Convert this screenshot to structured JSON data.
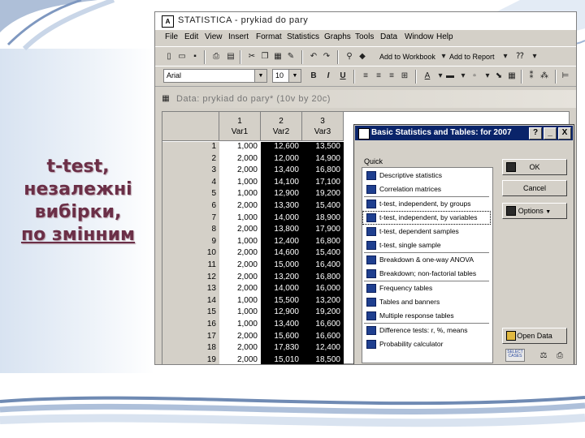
{
  "slide": {
    "title_lines": [
      "t-test,",
      "незалежні",
      "вибірки,",
      "по змінним"
    ]
  },
  "app": {
    "title": "STATISTICA - prykiad do pary",
    "icon_label": "A",
    "menu": [
      "File",
      "Edit",
      "View",
      "Insert",
      "Format",
      "Statistics",
      "Graphs",
      "Tools",
      "Data",
      "Window",
      "Help"
    ],
    "toolbar1": {
      "add_to_workbook": "Add to Workbook",
      "add_to_report": "Add to Report"
    },
    "toolbar2": {
      "font": "Arial",
      "size": "10",
      "bold": "B",
      "italic": "I",
      "underline": "U"
    }
  },
  "data_window": {
    "title": "Data: prykiad do pary* (10v by 20c)",
    "columns": [
      {
        "num": "1",
        "name": "Var1"
      },
      {
        "num": "2",
        "name": "Var2"
      },
      {
        "num": "3",
        "name": "Var3"
      }
    ],
    "rows": [
      {
        "n": "1",
        "v1": "1,000",
        "v2": "12,600",
        "v3": "13,500"
      },
      {
        "n": "2",
        "v1": "2,000",
        "v2": "12,000",
        "v3": "14,900"
      },
      {
        "n": "3",
        "v1": "2,000",
        "v2": "13,400",
        "v3": "16,800"
      },
      {
        "n": "4",
        "v1": "1,000",
        "v2": "14,100",
        "v3": "17,100"
      },
      {
        "n": "5",
        "v1": "1,000",
        "v2": "12,900",
        "v3": "19,200"
      },
      {
        "n": "6",
        "v1": "2,000",
        "v2": "13,300",
        "v3": "15,400"
      },
      {
        "n": "7",
        "v1": "1,000",
        "v2": "14,000",
        "v3": "18,900"
      },
      {
        "n": "8",
        "v1": "2,000",
        "v2": "13,800",
        "v3": "17,900"
      },
      {
        "n": "9",
        "v1": "1,000",
        "v2": "12,400",
        "v3": "16,800"
      },
      {
        "n": "10",
        "v1": "2,000",
        "v2": "14,600",
        "v3": "15,400"
      },
      {
        "n": "11",
        "v1": "2,000",
        "v2": "15,000",
        "v3": "16,400"
      },
      {
        "n": "12",
        "v1": "2,000",
        "v2": "13,200",
        "v3": "16,800"
      },
      {
        "n": "13",
        "v1": "2,000",
        "v2": "14,000",
        "v3": "16,000"
      },
      {
        "n": "14",
        "v1": "1,000",
        "v2": "15,500",
        "v3": "13,200"
      },
      {
        "n": "15",
        "v1": "1,000",
        "v2": "12,900",
        "v3": "19,200"
      },
      {
        "n": "16",
        "v1": "1,000",
        "v2": "13,400",
        "v3": "16,600"
      },
      {
        "n": "17",
        "v1": "2,000",
        "v2": "15,600",
        "v3": "16,600"
      },
      {
        "n": "18",
        "v1": "2,000",
        "v2": "17,830",
        "v3": "12,400"
      },
      {
        "n": "19",
        "v1": "2,000",
        "v2": "15,010",
        "v3": "18,500"
      }
    ]
  },
  "dialog": {
    "title": "Basic Statistics and Tables: for 2007",
    "help": "?",
    "minimize": "_",
    "close": "X",
    "tab_label": "Quick",
    "items": [
      "Descriptive statistics",
      "Correlation matrices",
      "t-test, independent, by groups",
      "t-test, independent, by variables",
      "t-test, dependent samples",
      "t-test, single sample",
      "Breakdown & one-way ANOVA",
      "Breakdown; non-factorial tables",
      "Frequency tables",
      "Tables and banners",
      "Multiple response tables",
      "Difference tests: r, %, means",
      "Probability calculator"
    ],
    "selected_index": 3,
    "ok_label": "OK",
    "cancel_label": "Cancel",
    "options_label": "Options",
    "open_data_label": "Open Data",
    "select_cases_label": "SELECT CASES"
  },
  "colors": {
    "title_color": "#6b2f47",
    "dialog_titlebar": "#0a246a",
    "window_face": "#d4d0c8"
  }
}
